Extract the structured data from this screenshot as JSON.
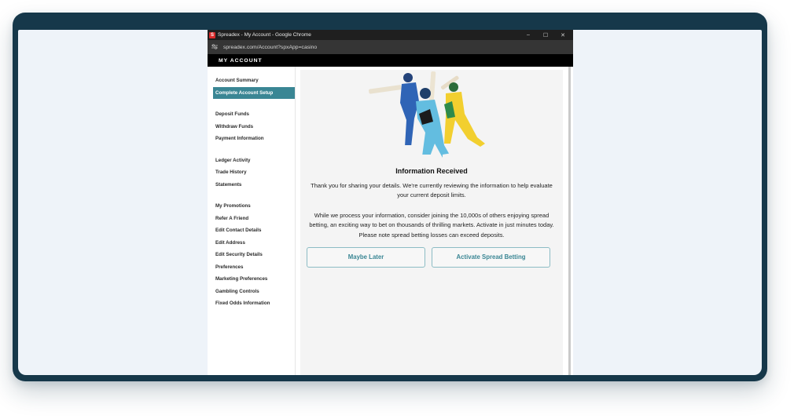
{
  "window": {
    "favicon_letter": "S",
    "title": "Spreadex - My Account - Google Chrome",
    "minimize": "–",
    "maximize": "☐",
    "close": "✕"
  },
  "address": {
    "icon": "tune-icon",
    "url": "spreadex.com/Account?spxApp=casino"
  },
  "app": {
    "header": "MY ACCOUNT"
  },
  "sidebar": {
    "items": [
      "Account Summary",
      "Complete Account Setup",
      "Deposit Funds",
      "Withdraw Funds",
      "Payment Information",
      "Ledger Activity",
      "Trade History",
      "Statements",
      "My Promotions",
      "Refer A Friend",
      "Edit Contact Details",
      "Edit Address",
      "Edit Security Details",
      "Preferences",
      "Marketing Preferences",
      "Gambling Controls",
      "Fixed Odds Information"
    ],
    "active_index": 1
  },
  "main": {
    "title": "Information Received",
    "paragraph1": "Thank you for sharing your details. We're currently reviewing the information to help evaluate your current deposit limits.",
    "paragraph2": "While we process your information, consider joining the 10,000s of others enjoying spread betting, an exciting way to bet on thousands of thrilling markets. Activate in just minutes today. Please note spread betting losses can exceed deposits.",
    "button_later": "Maybe Later",
    "button_activate": "Activate Spread Betting"
  },
  "colors": {
    "frame": "#16384a",
    "accent": "#3a8694",
    "button_border": "#8cbcc4",
    "browser_titlebar": "#1f1f1f",
    "addressbar": "#353535",
    "app_header": "#000000"
  }
}
